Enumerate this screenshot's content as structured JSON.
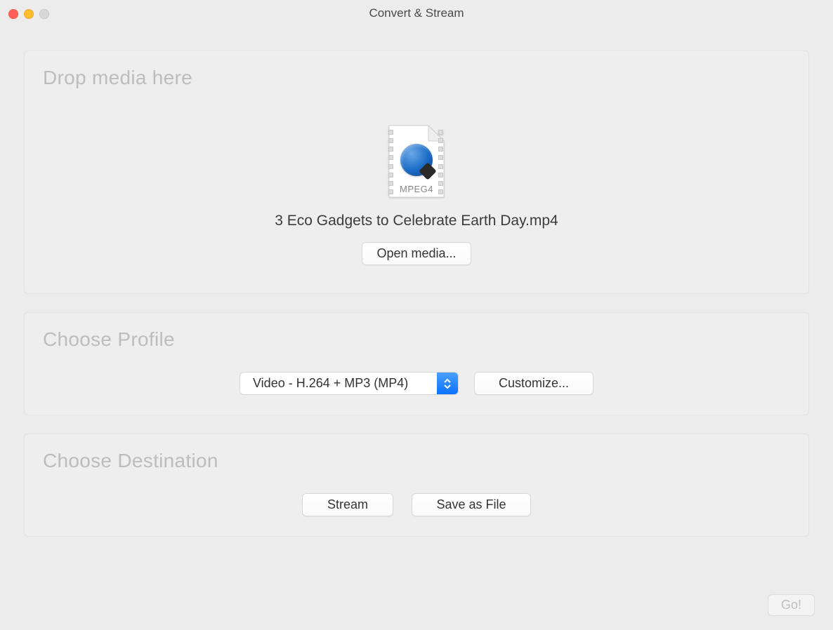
{
  "window": {
    "title": "Convert & Stream"
  },
  "drop": {
    "heading": "Drop media here",
    "file_icon_badge": "MPEG4",
    "filename": "3 Eco Gadgets to Celebrate Earth Day.mp4",
    "open_media_label": "Open media..."
  },
  "profile": {
    "heading": "Choose Profile",
    "selected": "Video - H.264 + MP3 (MP4)",
    "customize_label": "Customize..."
  },
  "destination": {
    "heading": "Choose Destination",
    "stream_label": "Stream",
    "save_as_file_label": "Save as File"
  },
  "footer": {
    "go_label": "Go!"
  }
}
